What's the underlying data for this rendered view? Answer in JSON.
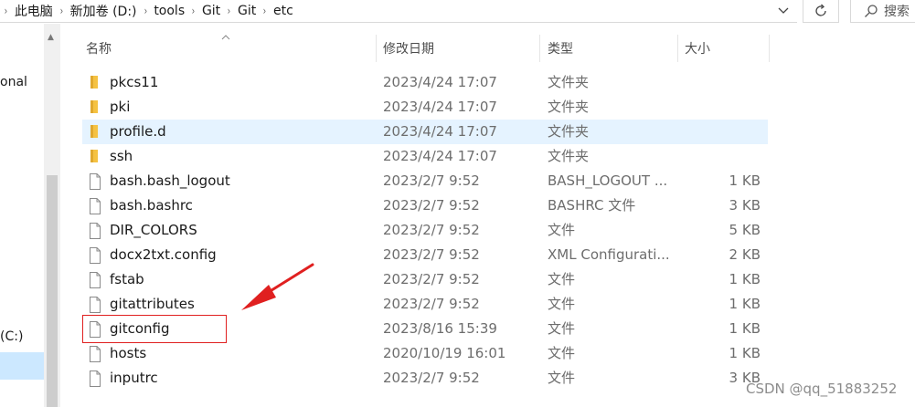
{
  "address_bar": {
    "crumbs": [
      "此电脑",
      "新加卷 (D:)",
      "tools",
      "Git",
      "Git",
      "etc"
    ],
    "search_placeholder": "搜索"
  },
  "nav_pane": {
    "partial_item_1": "onal",
    "partial_item_2": "(C:)"
  },
  "columns": {
    "name": "名称",
    "date": "修改日期",
    "type": "类型",
    "size": "大小"
  },
  "files": [
    {
      "name": "pkcs11",
      "date": "2023/4/24 17:07",
      "type": "文件夹",
      "size": "",
      "kind": "folder"
    },
    {
      "name": "pki",
      "date": "2023/4/24 17:07",
      "type": "文件夹",
      "size": "",
      "kind": "folder"
    },
    {
      "name": "profile.d",
      "date": "2023/4/24 17:07",
      "type": "文件夹",
      "size": "",
      "kind": "folder"
    },
    {
      "name": "ssh",
      "date": "2023/4/24 17:07",
      "type": "文件夹",
      "size": "",
      "kind": "folder"
    },
    {
      "name": "bash.bash_logout",
      "date": "2023/2/7 9:52",
      "type": "BASH_LOGOUT ...",
      "size": "1 KB",
      "kind": "file"
    },
    {
      "name": "bash.bashrc",
      "date": "2023/2/7 9:52",
      "type": "BASHRC 文件",
      "size": "3 KB",
      "kind": "file"
    },
    {
      "name": "DIR_COLORS",
      "date": "2023/2/7 9:52",
      "type": "文件",
      "size": "5 KB",
      "kind": "file"
    },
    {
      "name": "docx2txt.config",
      "date": "2023/2/7 9:52",
      "type": "XML Configurati...",
      "size": "2 KB",
      "kind": "file"
    },
    {
      "name": "fstab",
      "date": "2023/2/7 9:52",
      "type": "文件",
      "size": "1 KB",
      "kind": "file"
    },
    {
      "name": "gitattributes",
      "date": "2023/2/7 9:52",
      "type": "文件",
      "size": "1 KB",
      "kind": "file"
    },
    {
      "name": "gitconfig",
      "date": "2023/8/16 15:39",
      "type": "文件",
      "size": "1 KB",
      "kind": "file"
    },
    {
      "name": "hosts",
      "date": "2020/10/19 16:01",
      "type": "文件",
      "size": "1 KB",
      "kind": "file"
    },
    {
      "name": "inputrc",
      "date": "2023/2/7 9:52",
      "type": "文件",
      "size": "3 KB",
      "kind": "file"
    }
  ],
  "hovered_row": "profile.d",
  "annotated_file": "gitconfig",
  "watermark": "CSDN @qq_51883252",
  "colors": {
    "folder": "#f5c242",
    "hover": "#e5f3ff",
    "selection": "#cce8ff",
    "annotation": "#e02020"
  },
  "icons": {
    "folder": "folder-icon",
    "file": "file-icon",
    "refresh": "refresh-icon",
    "search": "search-icon",
    "dropdown": "chevron-down-icon"
  }
}
